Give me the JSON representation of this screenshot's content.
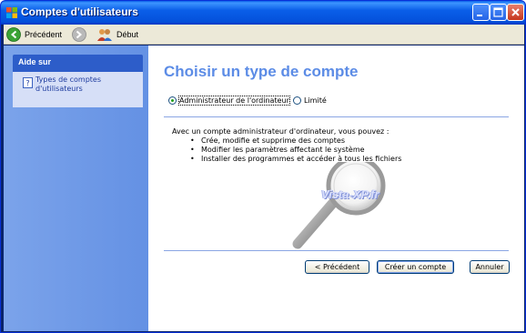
{
  "window": {
    "title": "Comptes d'utilisateurs"
  },
  "toolbar": {
    "back_label": "Précédent",
    "home_label": "Début"
  },
  "sidebar": {
    "panel_title": "Aide sur",
    "links": [
      {
        "label": "Types de comptes d'utilisateurs",
        "line1": "Types de comptes",
        "line2": "d'utilisateurs"
      }
    ]
  },
  "main": {
    "heading": "Choisir un type de compte",
    "account_types": [
      {
        "label": "Administrateur de l'ordinateur",
        "selected": true
      },
      {
        "label": "Limité",
        "selected": false
      }
    ],
    "description": "Avec un compte administrateur d'ordinateur, vous pouvez :",
    "capabilities": [
      "Crée, modifie et supprime des comptes",
      "Modifier les paramètres affectant le système",
      "Installer des programmes et accéder à tous les fichiers"
    ],
    "watermark": "Vista-XP.fr"
  },
  "buttons": {
    "back": "< Précédent",
    "create": "Créer un compte",
    "cancel": "Annuler"
  },
  "colors": {
    "title_blue": "#0a5ee8",
    "heading_blue": "#5c8ce6",
    "sidebar_blue": "#7ba3ea",
    "panel_header": "#2d5dc9"
  }
}
